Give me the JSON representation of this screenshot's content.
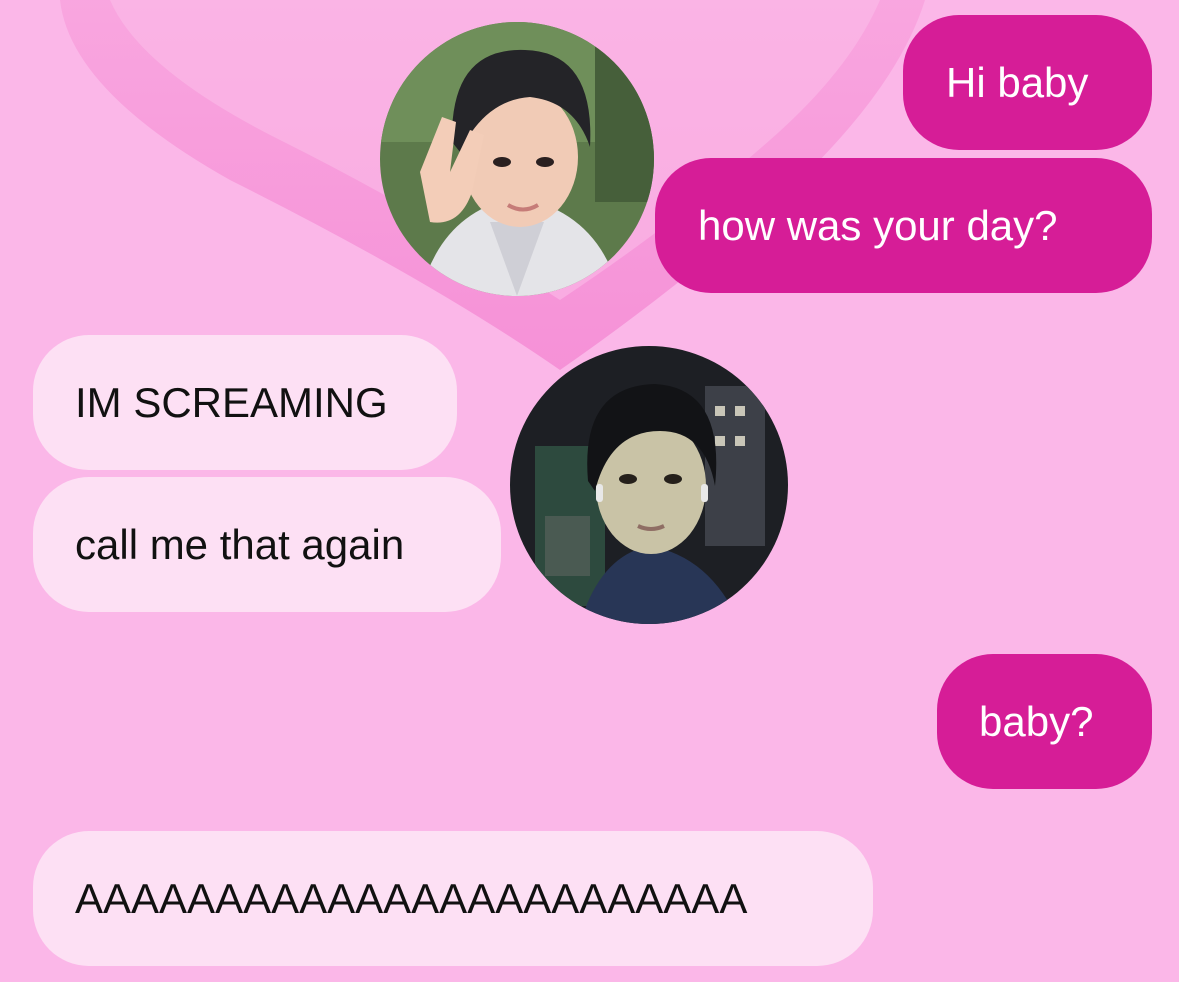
{
  "conversation": {
    "messages": [
      {
        "sender": "me",
        "text": "Hi baby"
      },
      {
        "sender": "me",
        "text": "how was your day?"
      },
      {
        "sender": "them",
        "text": "IM SCREAMING"
      },
      {
        "sender": "them",
        "text": "call me that again"
      },
      {
        "sender": "me",
        "text": "baby?"
      },
      {
        "sender": "them",
        "text": "AAAAAAAAAAAAAAAAAAAAAAAA"
      }
    ]
  },
  "colors": {
    "background": "#fbb7e8",
    "heart_decoration": "#f793d8",
    "outgoing_bubble": "#d61d97",
    "outgoing_text": "#ffffff",
    "incoming_bubble": "#fde0f4",
    "incoming_text": "#111111"
  },
  "avatars": {
    "top": {
      "icon": "user-photo-avatar",
      "description_colors": [
        "#2a2a2e",
        "#e9e9ec",
        "#f0c9b4"
      ]
    },
    "middle": {
      "icon": "user-photo-avatar",
      "description_colors": [
        "#1c1d22",
        "#283656",
        "#c7c2a6"
      ]
    }
  }
}
